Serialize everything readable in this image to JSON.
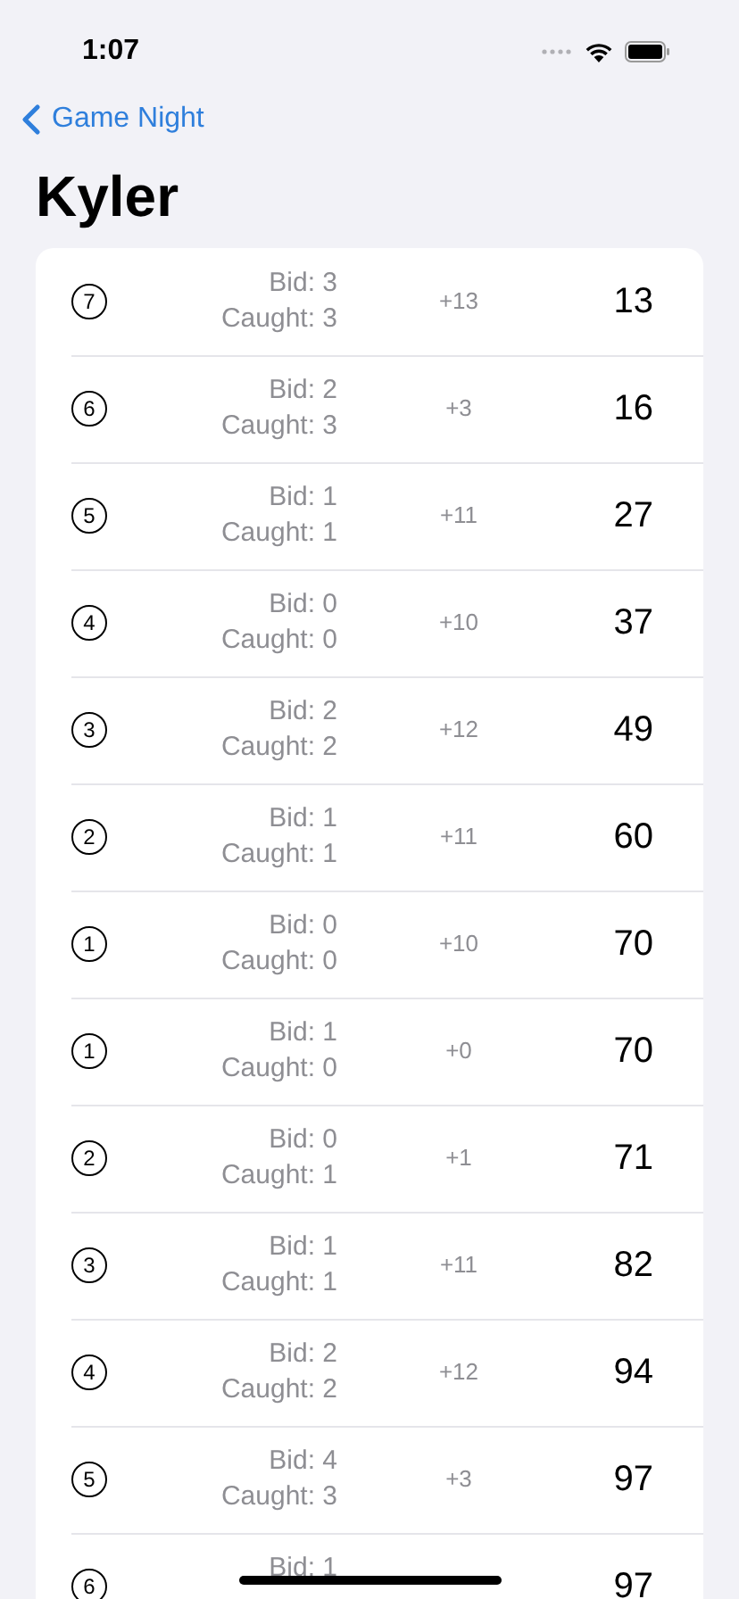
{
  "status_bar": {
    "time": "1:07"
  },
  "nav": {
    "back_label": "Game Night"
  },
  "title": "Kyler",
  "rounds": [
    {
      "round": "7",
      "bid": "Bid: 3",
      "caught": "Caught: 3",
      "delta": "+13",
      "total": "13"
    },
    {
      "round": "6",
      "bid": "Bid: 2",
      "caught": "Caught: 3",
      "delta": "+3",
      "total": "16"
    },
    {
      "round": "5",
      "bid": "Bid: 1",
      "caught": "Caught: 1",
      "delta": "+11",
      "total": "27"
    },
    {
      "round": "4",
      "bid": "Bid: 0",
      "caught": "Caught: 0",
      "delta": "+10",
      "total": "37"
    },
    {
      "round": "3",
      "bid": "Bid: 2",
      "caught": "Caught: 2",
      "delta": "+12",
      "total": "49"
    },
    {
      "round": "2",
      "bid": "Bid: 1",
      "caught": "Caught: 1",
      "delta": "+11",
      "total": "60"
    },
    {
      "round": "1",
      "bid": "Bid: 0",
      "caught": "Caught: 0",
      "delta": "+10",
      "total": "70"
    },
    {
      "round": "1",
      "bid": "Bid: 1",
      "caught": "Caught: 0",
      "delta": "+0",
      "total": "70"
    },
    {
      "round": "2",
      "bid": "Bid: 0",
      "caught": "Caught: 1",
      "delta": "+1",
      "total": "71"
    },
    {
      "round": "3",
      "bid": "Bid: 1",
      "caught": "Caught: 1",
      "delta": "+11",
      "total": "82"
    },
    {
      "round": "4",
      "bid": "Bid: 2",
      "caught": "Caught: 2",
      "delta": "+12",
      "total": "94"
    },
    {
      "round": "5",
      "bid": "Bid: 4",
      "caught": "Caught: 3",
      "delta": "+3",
      "total": "97"
    },
    {
      "round": "6",
      "bid": "Bid: 1",
      "total": "97"
    }
  ]
}
